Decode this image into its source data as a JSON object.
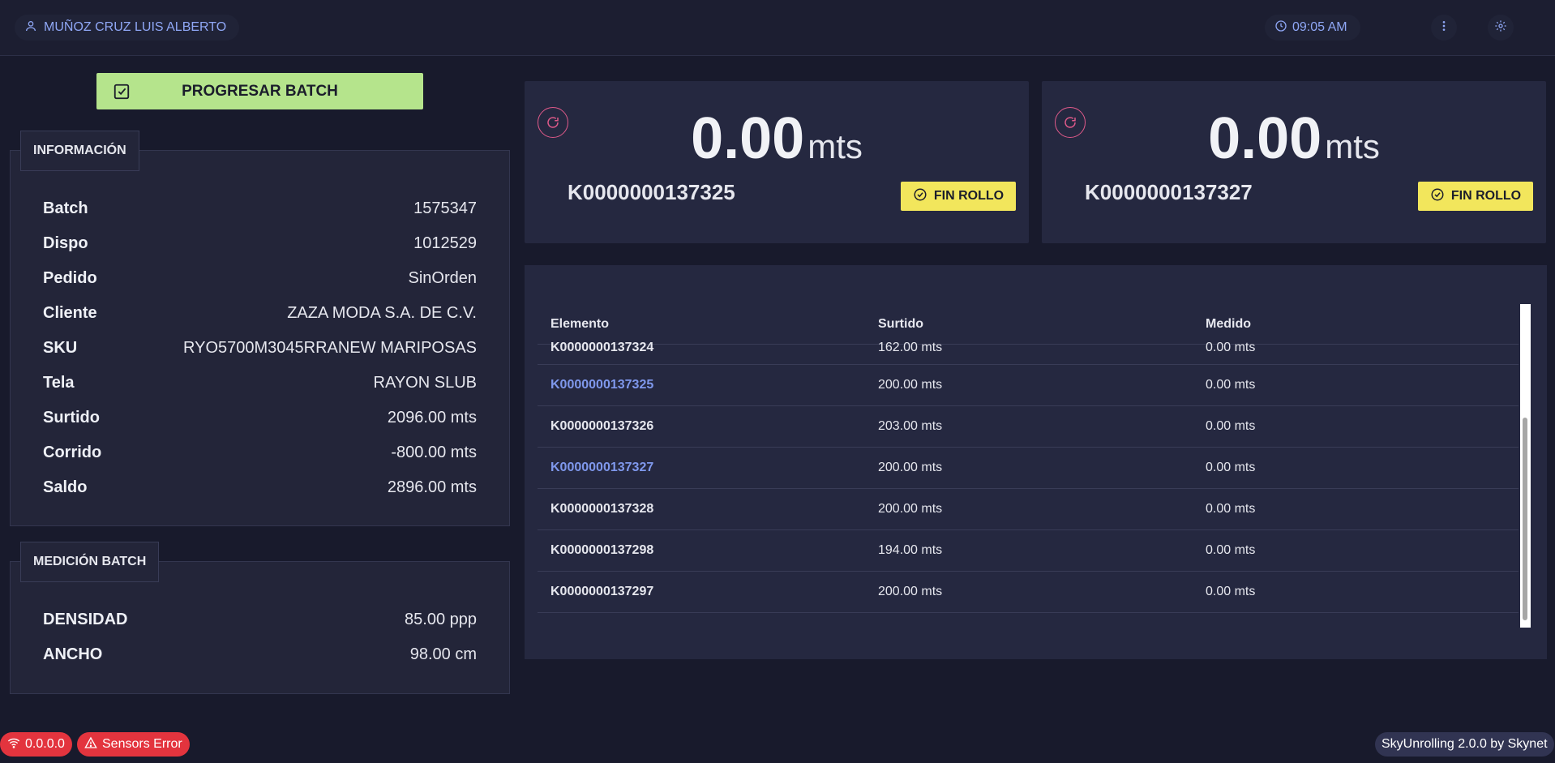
{
  "header": {
    "user_name": "MUÑOZ CRUZ LUIS ALBERTO",
    "time": "09:05 AM"
  },
  "actions": {
    "progress_batch": "PROGRESAR BATCH"
  },
  "info": {
    "title": "INFORMACIÓN",
    "rows": [
      {
        "label": "Batch",
        "value": "1575347"
      },
      {
        "label": "Dispo",
        "value": "1012529"
      },
      {
        "label": "Pedido",
        "value": "SinOrden"
      },
      {
        "label": "Cliente",
        "value": "ZAZA MODA S.A. DE C.V."
      },
      {
        "label": "SKU",
        "value": "RYO5700M3045RRANEW MARIPOSAS"
      },
      {
        "label": "Tela",
        "value": "RAYON SLUB"
      },
      {
        "label": "Surtido",
        "value": "2096.00 mts"
      },
      {
        "label": "Corrido",
        "value": "-800.00 mts"
      },
      {
        "label": "Saldo",
        "value": "2896.00 mts"
      }
    ]
  },
  "measurement": {
    "title": "MEDICIÓN BATCH",
    "rows": [
      {
        "label": "DENSIDAD",
        "value": "85.00 ppp"
      },
      {
        "label": "ANCHO",
        "value": "98.00 cm"
      }
    ]
  },
  "rolls": [
    {
      "value": "0.00",
      "unit": "mts",
      "id": "K0000000137325",
      "button": "FIN ROLLO"
    },
    {
      "value": "0.00",
      "unit": "mts",
      "id": "K0000000137327",
      "button": "FIN ROLLO"
    }
  ],
  "table": {
    "headers": [
      "Elemento",
      "Surtido",
      "Medido"
    ],
    "rows": [
      {
        "element": "K0000000137324",
        "surtido": "162.00 mts",
        "medido": "0.00 mts",
        "highlight": false
      },
      {
        "element": "K0000000137325",
        "surtido": "200.00 mts",
        "medido": "0.00 mts",
        "highlight": true
      },
      {
        "element": "K0000000137326",
        "surtido": "203.00 mts",
        "medido": "0.00 mts",
        "highlight": false
      },
      {
        "element": "K0000000137327",
        "surtido": "200.00 mts",
        "medido": "0.00 mts",
        "highlight": true
      },
      {
        "element": "K0000000137328",
        "surtido": "200.00 mts",
        "medido": "0.00 mts",
        "highlight": false
      },
      {
        "element": "K0000000137298",
        "surtido": "194.00 mts",
        "medido": "0.00 mts",
        "highlight": false
      },
      {
        "element": "K0000000137297",
        "surtido": "200.00 mts",
        "medido": "0.00 mts",
        "highlight": false
      }
    ]
  },
  "footer": {
    "ip": "0.0.0.0",
    "sensors_error": "Sensors Error",
    "version": "SkyUnrolling 2.0.0 by Skynet"
  },
  "colors": {
    "background": "#181a2c",
    "accent": "#8fa7f5",
    "progress_button": "#b5e48c",
    "fin_button": "#f2e65c",
    "error": "#e3343e",
    "highlight_row": "#7f98ec"
  },
  "icons": {
    "user": "user-icon",
    "clock": "clock-icon",
    "menu": "more-vertical-icon",
    "settings": "gear-icon",
    "refresh": "refresh-icon",
    "check": "check-circle-icon",
    "checkbox": "check-square-icon",
    "wifi": "wifi-icon",
    "warning": "warning-icon"
  }
}
